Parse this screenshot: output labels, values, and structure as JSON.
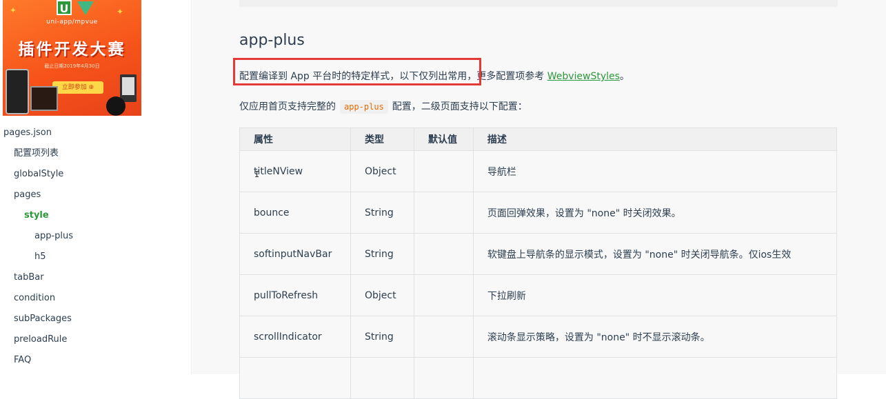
{
  "banner": {
    "logo_letter": "U",
    "subtitle": "uni-app/mpvue",
    "title": "插件开发大赛",
    "date": "截止日期2019年4月30日",
    "button": "立即参加 ⊕"
  },
  "sidebar": {
    "items": [
      {
        "label": "pages.json",
        "level": 0
      },
      {
        "label": "配置项列表",
        "level": 1
      },
      {
        "label": "globalStyle",
        "level": 1
      },
      {
        "label": "pages",
        "level": 1
      },
      {
        "label": "style",
        "level": 2,
        "active": true
      },
      {
        "label": "app-plus",
        "level": 3
      },
      {
        "label": "h5",
        "level": 3
      },
      {
        "label": "tabBar",
        "level": 1
      },
      {
        "label": "condition",
        "level": 1
      },
      {
        "label": "subPackages",
        "level": 1
      },
      {
        "label": "preloadRule",
        "level": 1
      },
      {
        "label": "FAQ",
        "level": 1
      }
    ]
  },
  "content": {
    "heading": "app-plus",
    "para1_text": "配置编译到 App 平台时的特定样式，以下仅列出常用，更多配置项参考 ",
    "para1_link": "WebviewStyles",
    "para1_end": "。",
    "para2_before": "仅应用首页支持完整的",
    "para2_code": "app-plus",
    "para2_after": "配置，二级页面支持以下配置："
  },
  "table": {
    "headers": [
      "属性",
      "类型",
      "默认值",
      "描述"
    ],
    "rows": [
      [
        "titleNView",
        "Object",
        "",
        "导航栏"
      ],
      [
        "bounce",
        "String",
        "",
        "页面回弹效果，设置为 \"none\" 时关闭效果。"
      ],
      [
        "softinputNavBar",
        "String",
        "",
        "软键盘上导航条的显示模式，设置为 \"none\" 时关闭导航条。仅ios生效"
      ],
      [
        "pullToRefresh",
        "Object",
        "",
        "下拉刷新"
      ],
      [
        "scrollIndicator",
        "String",
        "",
        "滚动条显示策略，设置为 \"none\" 时不显示滚动条。"
      ]
    ]
  },
  "colors": {
    "accent": "#2b9939",
    "highlight_border": "#e53935",
    "code": "#e96900"
  }
}
